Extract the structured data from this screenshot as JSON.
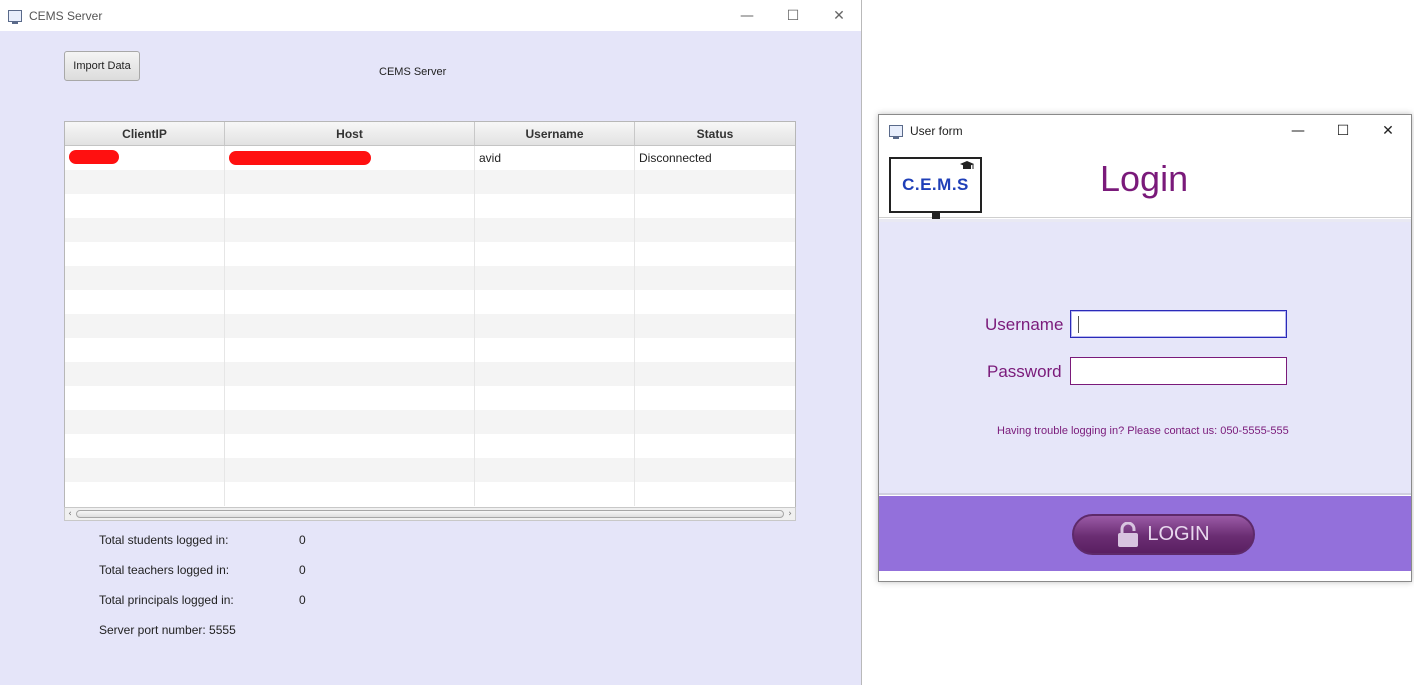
{
  "server_window": {
    "title": "CEMS Server",
    "controls": {
      "minimize": "—",
      "maximize": "☐",
      "close": "✕"
    },
    "import_button": "Import Data",
    "heading": "CEMS Server",
    "table": {
      "columns": [
        "ClientIP",
        "Host",
        "Username",
        "Status"
      ],
      "rows": [
        {
          "client_ip": "",
          "host": "",
          "username": "avid",
          "status": "Disconnected"
        }
      ]
    },
    "stats": {
      "students_label": "Total students logged in:",
      "students_value": "0",
      "teachers_label": "Total teachers logged in:",
      "teachers_value": "0",
      "principals_label": "Total principals logged in:",
      "principals_value": "0",
      "port_label": "Server port number: 5555"
    }
  },
  "login_window": {
    "title": "User form",
    "controls": {
      "minimize": "—",
      "maximize": "☐",
      "close": "✕"
    },
    "logo_text": "C.E.M.S",
    "heading": "Login",
    "username_label": "Username",
    "username_value": "",
    "password_label": "Password",
    "password_value": "",
    "help_text": "Having trouble logging in? Please contact us: 050-5555-555",
    "login_button": "LOGIN"
  },
  "colors": {
    "accent_purple": "#7a1a7a",
    "footer_purple": "#9370db",
    "panel_lavender": "#e5e5f9",
    "logo_blue": "#1f3fb8",
    "redaction_red": "#ff1010"
  }
}
